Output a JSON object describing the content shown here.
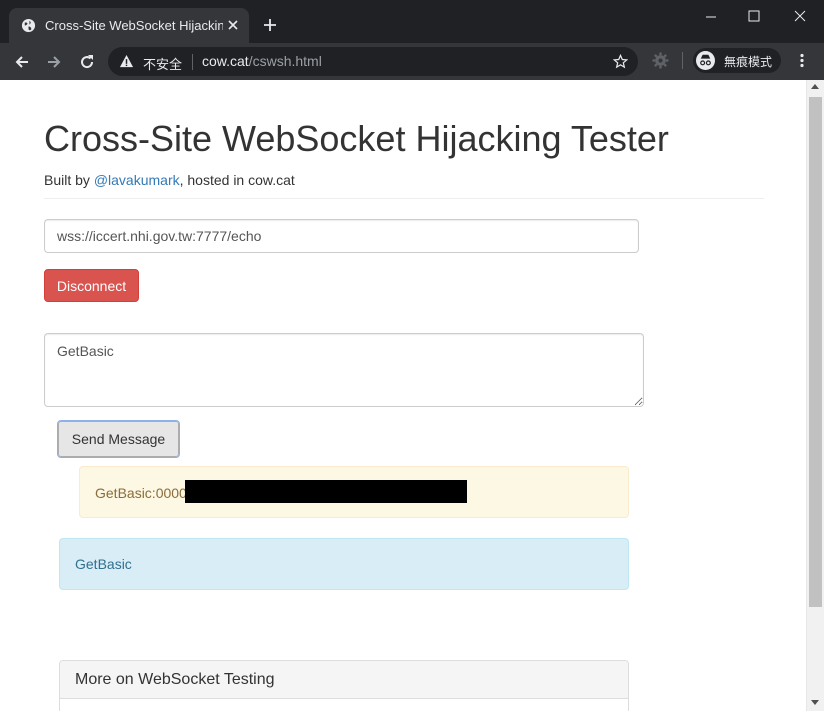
{
  "browser": {
    "tab_title": "Cross-Site WebSocket Hijacking Tester",
    "insecure_label": "不安全",
    "url_host": "cow.cat",
    "url_path": "/cswsh.html",
    "incognito_label": "無痕模式",
    "icons": [
      "globe-icon",
      "close-icon",
      "plus-icon",
      "minimize-icon",
      "maximize-icon",
      "back-icon",
      "forward-icon",
      "reload-icon",
      "warning-icon",
      "star-icon",
      "gear-icon",
      "incognito-icon",
      "menu-icon"
    ]
  },
  "page": {
    "title": "Cross-Site WebSocket Hijacking Tester",
    "byline_prefix": "Built by ",
    "author_link": "@lavakumark",
    "byline_suffix": ", hosted in cow.cat",
    "ws_url": "wss://iccert.nhi.gov.tw:7777/echo",
    "disconnect_label": "Disconnect",
    "message": "GetBasic",
    "send_label": "Send Message",
    "response_text": "GetBasic:0000",
    "sent_text": "GetBasic",
    "panel_heading": "More on WebSocket Testing"
  },
  "colors": {
    "danger": "#d9534f",
    "link": "#337ab7",
    "warning_bg": "#fcf8e3",
    "info_bg": "#d9edf7"
  }
}
